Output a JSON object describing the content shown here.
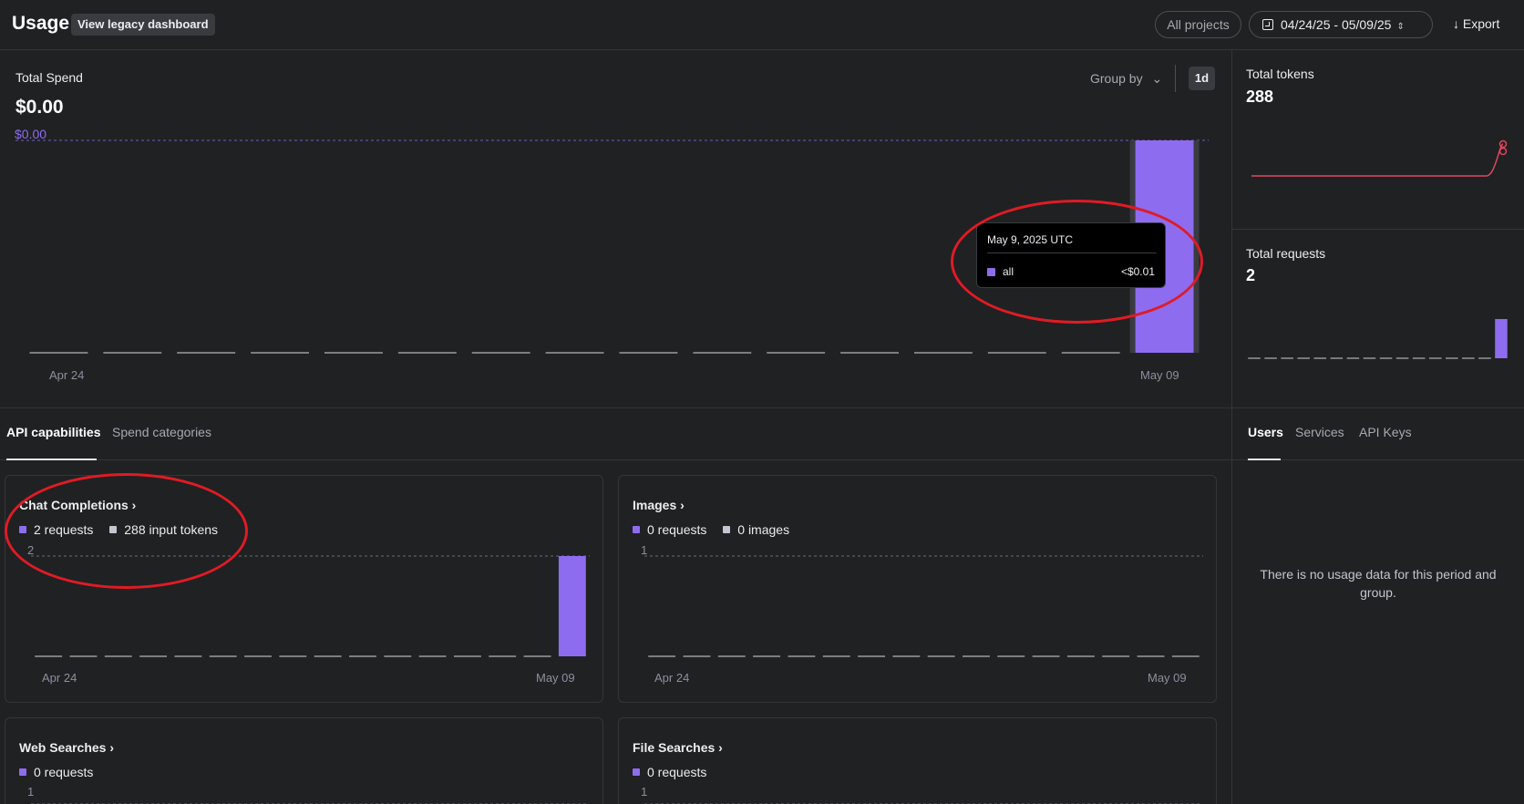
{
  "header": {
    "title": "Usage",
    "legacy_button": "View legacy dashboard",
    "projects_filter": "All projects",
    "date_range": "04/24/25 - 05/09/25",
    "export_label": "Export"
  },
  "spend": {
    "label": "Total Spend",
    "value": "$0.00",
    "group_by": "Group by",
    "period": "1d",
    "ref_line_label": "$0.00",
    "x_start": "Apr 24",
    "x_end": "May 09",
    "tooltip": {
      "date": "May 9, 2025 UTC",
      "series": "all",
      "value": "<$0.01"
    }
  },
  "right_panel": {
    "tokens_label": "Total tokens",
    "tokens_value": "288",
    "requests_label": "Total requests",
    "requests_value": "2",
    "tabs": [
      "Users",
      "Services",
      "API Keys"
    ],
    "empty_message": "There is no usage data for this period and group."
  },
  "tabs": {
    "api_capabilities": "API capabilities",
    "spend_categories": "Spend categories"
  },
  "cards": {
    "chat": {
      "title": "Chat Completions",
      "legend1": "2 requests",
      "legend2": "288 input tokens",
      "ymax": "2",
      "x_start": "Apr 24",
      "x_end": "May 09"
    },
    "images": {
      "title": "Images",
      "legend1": "0 requests",
      "legend2": "0 images",
      "ymax": "1",
      "x_start": "Apr 24",
      "x_end": "May 09"
    },
    "web": {
      "title": "Web Searches",
      "legend1": "0 requests",
      "ymax": "1"
    },
    "file": {
      "title": "File Searches",
      "legend1": "0 requests",
      "ymax": "1"
    }
  },
  "colors": {
    "accent": "#8e6cf0",
    "tokens_line": "#e0475d",
    "annotation": "#e01b24"
  },
  "chart_data": [
    {
      "type": "bar",
      "title": "Total Spend",
      "categories": [
        "Apr 24",
        "Apr 25",
        "Apr 26",
        "Apr 27",
        "Apr 28",
        "Apr 29",
        "Apr 30",
        "May 01",
        "May 02",
        "May 03",
        "May 04",
        "May 05",
        "May 06",
        "May 07",
        "May 08",
        "May 09"
      ],
      "values": [
        0,
        0,
        0,
        0,
        0,
        0,
        0,
        0,
        0,
        0,
        0,
        0,
        0,
        0,
        0,
        0.01
      ],
      "ylim": [
        0,
        0.01
      ]
    },
    {
      "type": "line",
      "title": "Total tokens",
      "categories": [
        "Apr 24",
        "Apr 25",
        "Apr 26",
        "Apr 27",
        "Apr 28",
        "Apr 29",
        "Apr 30",
        "May 01",
        "May 02",
        "May 03",
        "May 04",
        "May 05",
        "May 06",
        "May 07",
        "May 08",
        "May 09"
      ],
      "values": [
        0,
        0,
        0,
        0,
        0,
        0,
        0,
        0,
        0,
        0,
        0,
        0,
        0,
        0,
        0,
        288
      ]
    },
    {
      "type": "bar",
      "title": "Total requests",
      "categories": [
        "Apr 24",
        "Apr 25",
        "Apr 26",
        "Apr 27",
        "Apr 28",
        "Apr 29",
        "Apr 30",
        "May 01",
        "May 02",
        "May 03",
        "May 04",
        "May 05",
        "May 06",
        "May 07",
        "May 08",
        "May 09"
      ],
      "values": [
        0,
        0,
        0,
        0,
        0,
        0,
        0,
        0,
        0,
        0,
        0,
        0,
        0,
        0,
        0,
        2
      ]
    },
    {
      "type": "bar",
      "title": "Chat Completions",
      "categories": [
        "Apr 24",
        "Apr 25",
        "Apr 26",
        "Apr 27",
        "Apr 28",
        "Apr 29",
        "Apr 30",
        "May 01",
        "May 02",
        "May 03",
        "May 04",
        "May 05",
        "May 06",
        "May 07",
        "May 08",
        "May 09"
      ],
      "values": [
        0,
        0,
        0,
        0,
        0,
        0,
        0,
        0,
        0,
        0,
        0,
        0,
        0,
        0,
        0,
        2
      ],
      "ylim": [
        0,
        2
      ]
    },
    {
      "type": "bar",
      "title": "Images",
      "categories": [
        "Apr 24",
        "Apr 25",
        "Apr 26",
        "Apr 27",
        "Apr 28",
        "Apr 29",
        "Apr 30",
        "May 01",
        "May 02",
        "May 03",
        "May 04",
        "May 05",
        "May 06",
        "May 07",
        "May 08",
        "May 09"
      ],
      "values": [
        0,
        0,
        0,
        0,
        0,
        0,
        0,
        0,
        0,
        0,
        0,
        0,
        0,
        0,
        0,
        0
      ],
      "ylim": [
        0,
        1
      ]
    }
  ]
}
